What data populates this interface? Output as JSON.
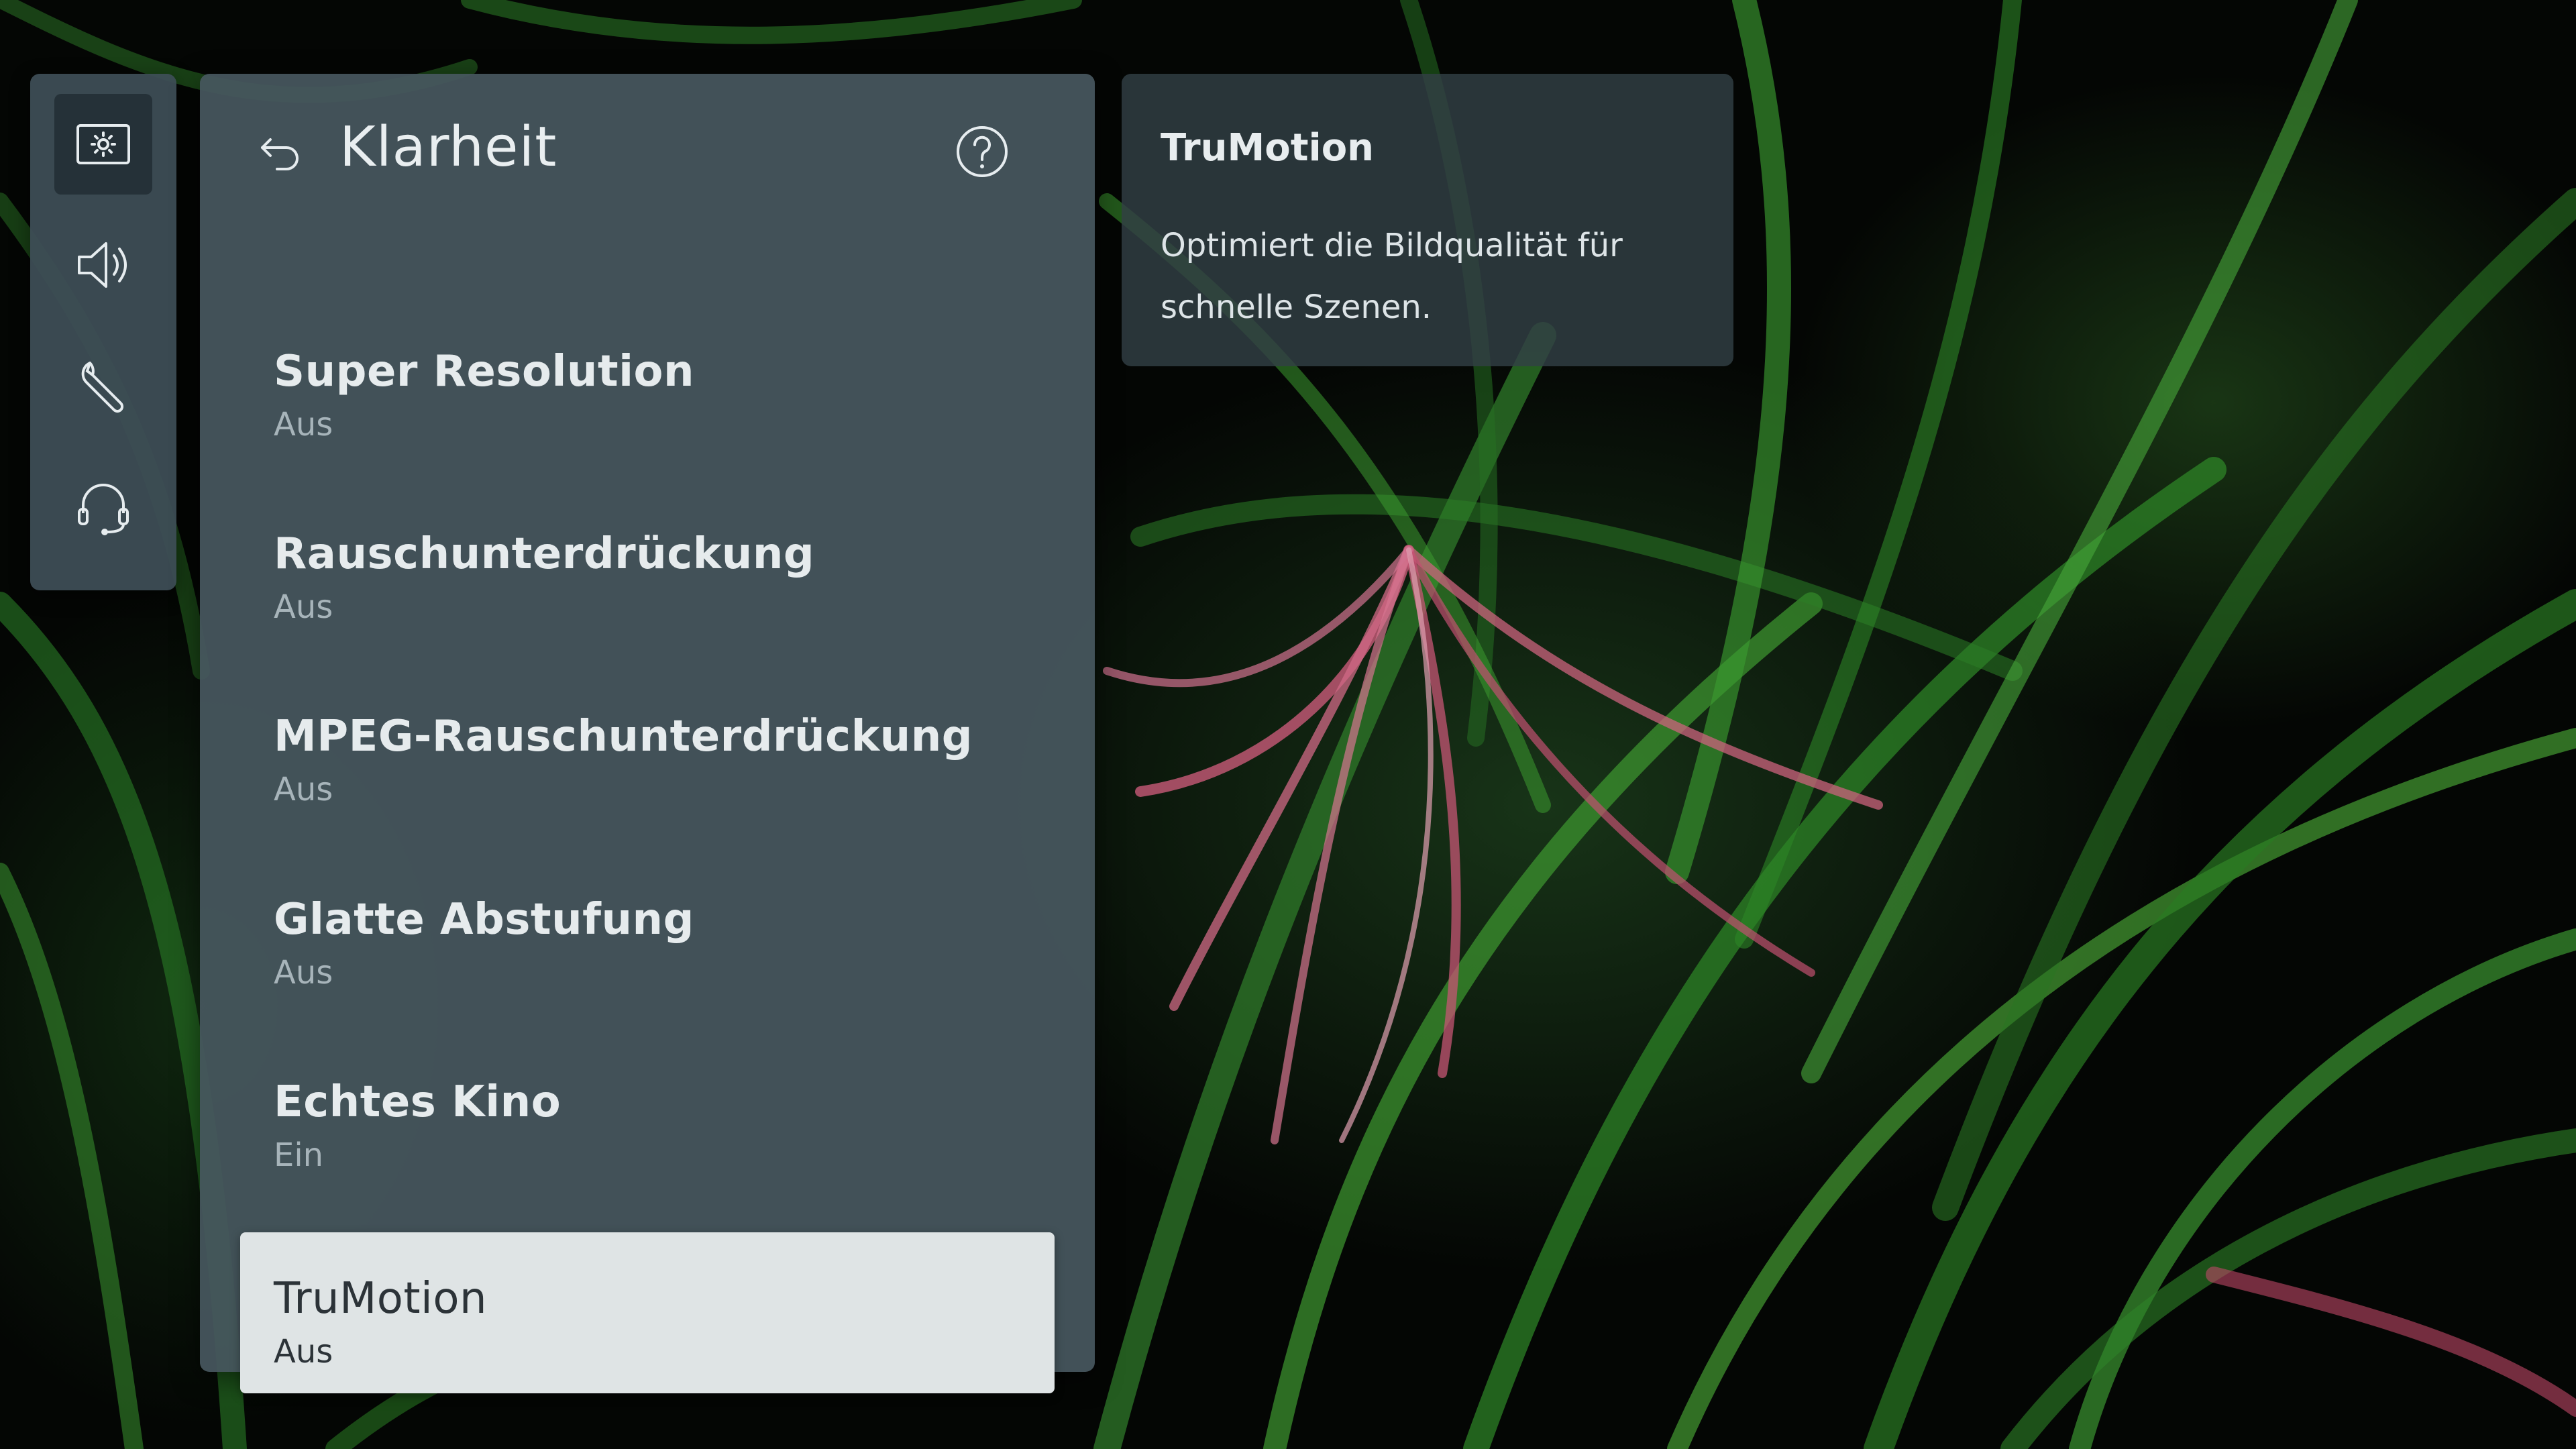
{
  "sidebar": {
    "items": [
      {
        "icon": "picture-settings-icon",
        "active": true
      },
      {
        "icon": "speaker-icon",
        "active": false
      },
      {
        "icon": "wrench-icon",
        "active": false
      },
      {
        "icon": "headset-support-icon",
        "active": false
      }
    ]
  },
  "panel": {
    "title": "Klarheit",
    "back_icon": "back-arrow-icon",
    "help_icon": "help-icon",
    "items": [
      {
        "label": "Super Resolution",
        "value": "Aus"
      },
      {
        "label": "Rauschunterdrückung",
        "value": "Aus"
      },
      {
        "label": "MPEG-Rauschunterdrückung",
        "value": "Aus"
      },
      {
        "label": "Glatte Abstufung",
        "value": "Aus"
      },
      {
        "label": "Echtes Kino",
        "value": "Ein"
      },
      {
        "label": "TruMotion",
        "value": "Aus",
        "selected": true
      }
    ]
  },
  "info": {
    "title": "TruMotion",
    "description": "Optimiert die Bildqualität für schnelle Szenen."
  }
}
